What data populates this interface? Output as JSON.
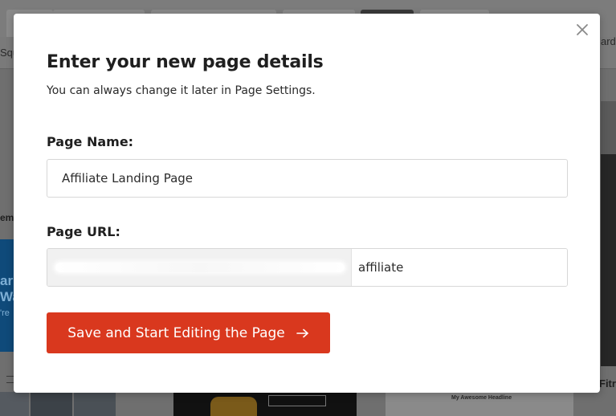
{
  "background": {
    "left_text": "Squ",
    "right_text": "ard",
    "left_label": "em",
    "right_label": "Fitr",
    "promo_text": [
      "ar",
      "Wa",
      "'re"
    ],
    "headline_text": "My Awesome Headline"
  },
  "modal": {
    "title": "Enter your new page details",
    "subtitle": "You can always change it later in Page Settings.",
    "page_name": {
      "label": "Page Name:",
      "value": "Affiliate Landing Page"
    },
    "page_url": {
      "label": "Page URL:",
      "prefix": "(blurred domain)",
      "slug": "affiliate"
    },
    "submit_label": "Save and Start Editing the Page",
    "icons": {
      "close": "close-icon",
      "arrow": "arrow-right-icon"
    }
  },
  "colors": {
    "accent": "#d9381e",
    "overlay": "#6f6f6f",
    "text": "#1f1f1f"
  }
}
